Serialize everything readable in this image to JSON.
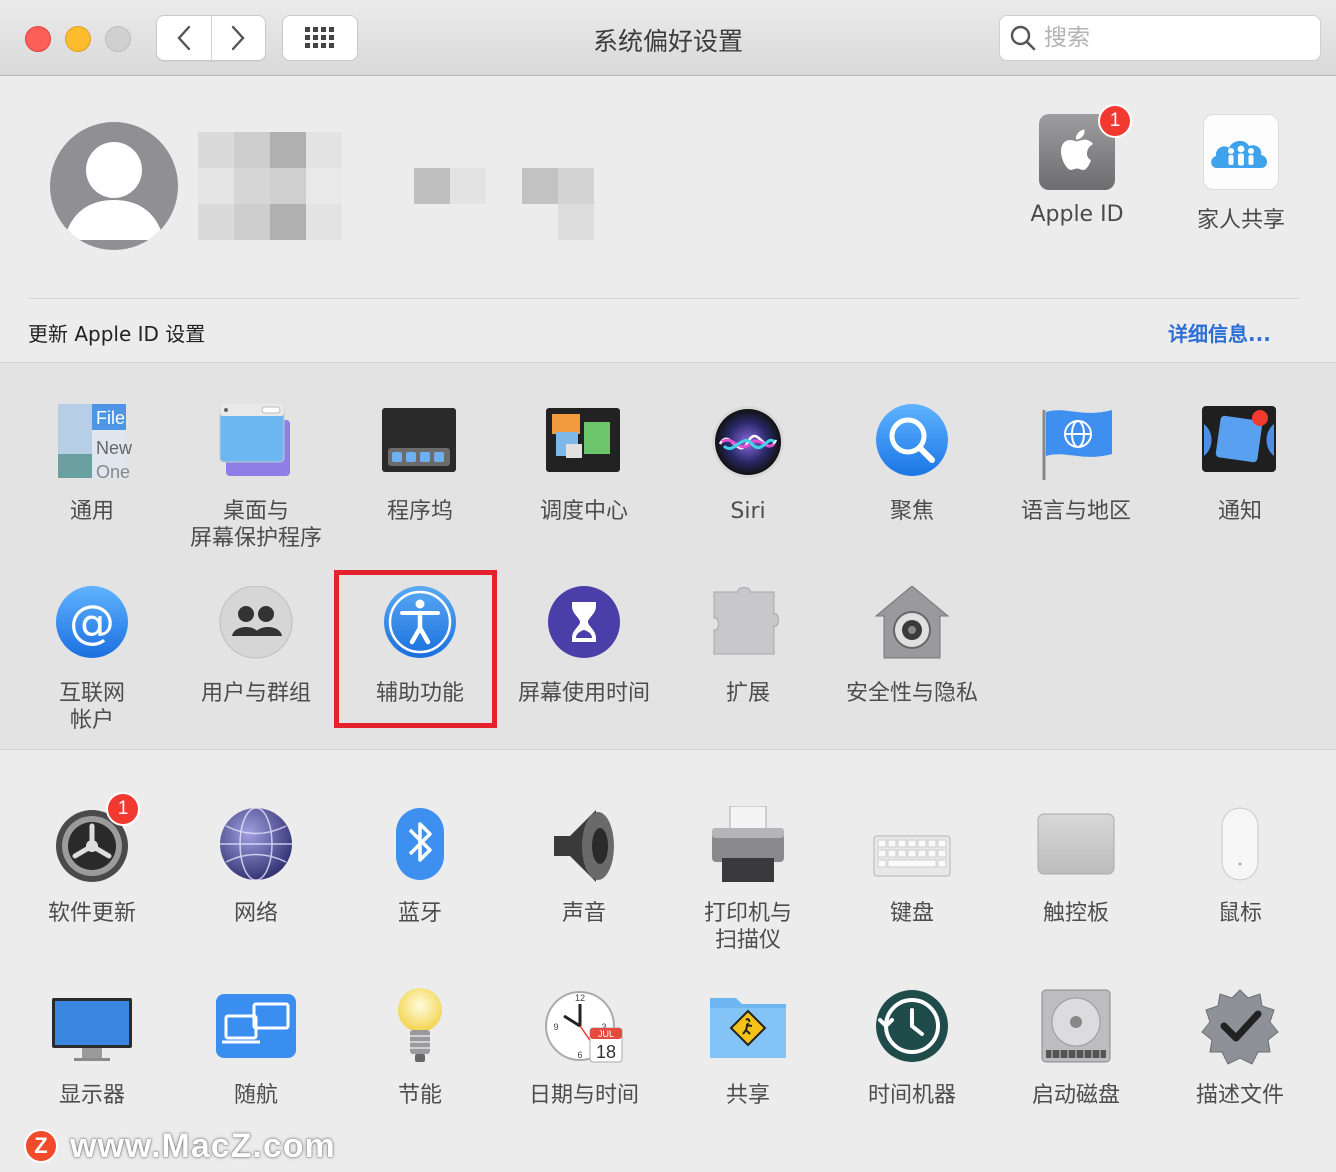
{
  "window": {
    "title": "系统偏好设置",
    "search_placeholder": "搜索"
  },
  "account": {
    "apple_id_label": "Apple ID",
    "apple_id_badge": "1",
    "family_label": "家人共享"
  },
  "update_banner": {
    "text": "更新 Apple ID 设置",
    "link": "详细信息..."
  },
  "panes_row1": [
    {
      "label": "通用",
      "icon": "general-icon",
      "file_text": "File",
      "new_text": "New",
      "one_text": "One"
    },
    {
      "label": "桌面与\n屏幕保护程序",
      "icon": "desktop-screensaver-icon"
    },
    {
      "label": "程序坞",
      "icon": "dock-icon"
    },
    {
      "label": "调度中心",
      "icon": "mission-control-icon"
    },
    {
      "label": "Siri",
      "icon": "siri-icon"
    },
    {
      "label": "聚焦",
      "icon": "spotlight-icon"
    },
    {
      "label": "语言与地区",
      "icon": "language-region-icon"
    },
    {
      "label": "通知",
      "icon": "notifications-icon"
    }
  ],
  "panes_row2": [
    {
      "label": "互联网\n帐户",
      "icon": "internet-accounts-icon"
    },
    {
      "label": "用户与群组",
      "icon": "users-groups-icon"
    },
    {
      "label": "辅助功能",
      "icon": "accessibility-icon"
    },
    {
      "label": "屏幕使用时间",
      "icon": "screen-time-icon"
    },
    {
      "label": "扩展",
      "icon": "extensions-icon"
    },
    {
      "label": "安全性与隐私",
      "icon": "security-privacy-icon"
    }
  ],
  "panes_row3": [
    {
      "label": "软件更新",
      "icon": "software-update-icon",
      "badge": "1"
    },
    {
      "label": "网络",
      "icon": "network-icon"
    },
    {
      "label": "蓝牙",
      "icon": "bluetooth-icon"
    },
    {
      "label": "声音",
      "icon": "sound-icon"
    },
    {
      "label": "打印机与\n扫描仪",
      "icon": "printers-scanners-icon"
    },
    {
      "label": "键盘",
      "icon": "keyboard-icon"
    },
    {
      "label": "触控板",
      "icon": "trackpad-icon"
    },
    {
      "label": "鼠标",
      "icon": "mouse-icon"
    }
  ],
  "panes_row4": [
    {
      "label": "显示器",
      "icon": "displays-icon"
    },
    {
      "label": "随航",
      "icon": "sidecar-icon"
    },
    {
      "label": "节能",
      "icon": "energy-saver-icon"
    },
    {
      "label": "日期与时间",
      "icon": "date-time-icon",
      "month": "JUL",
      "day": "18"
    },
    {
      "label": "共享",
      "icon": "sharing-icon"
    },
    {
      "label": "时间机器",
      "icon": "time-machine-icon"
    },
    {
      "label": "启动磁盘",
      "icon": "startup-disk-icon"
    },
    {
      "label": "描述文件",
      "icon": "profiles-icon"
    }
  ],
  "watermark": {
    "logo": "Z",
    "text": "www.MacZ.com"
  },
  "colors": {
    "highlight": "#e3222c",
    "link": "#2d6fd6",
    "badge": "#f2392f"
  }
}
